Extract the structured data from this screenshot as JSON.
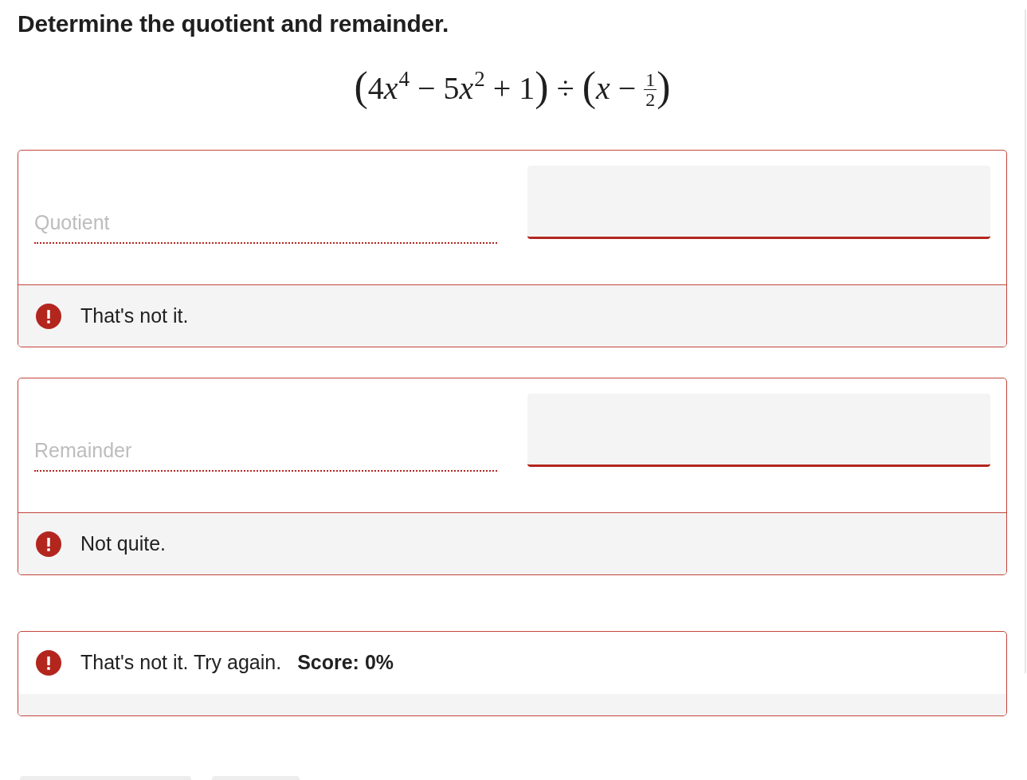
{
  "title": "Determine the quotient and remainder.",
  "expression": [
    {
      "kind": "paren",
      "text": "("
    },
    {
      "kind": "text",
      "text": "4"
    },
    {
      "kind": "var",
      "text": "x"
    },
    {
      "kind": "sup",
      "text": "4"
    },
    {
      "kind": "text",
      "text": " − 5"
    },
    {
      "kind": "var",
      "text": "x"
    },
    {
      "kind": "sup",
      "text": "2"
    },
    {
      "kind": "text",
      "text": " + 1"
    },
    {
      "kind": "paren",
      "text": ")"
    },
    {
      "kind": "text",
      "text": " ÷ "
    },
    {
      "kind": "paren",
      "text": "("
    },
    {
      "kind": "var",
      "text": "x"
    },
    {
      "kind": "text",
      "text": " − "
    },
    {
      "kind": "fraction",
      "numerator": "1",
      "denominator": "2"
    },
    {
      "kind": "paren",
      "text": ")"
    }
  ],
  "parts": [
    {
      "placeholder": "Quotient",
      "correct": false,
      "feedback": "That's not it."
    },
    {
      "placeholder": "Remainder",
      "correct": false,
      "feedback": "Not quite."
    }
  ],
  "summary": {
    "correct": false,
    "message": "That's not it. Try again.",
    "score": "Score: 0%"
  }
}
